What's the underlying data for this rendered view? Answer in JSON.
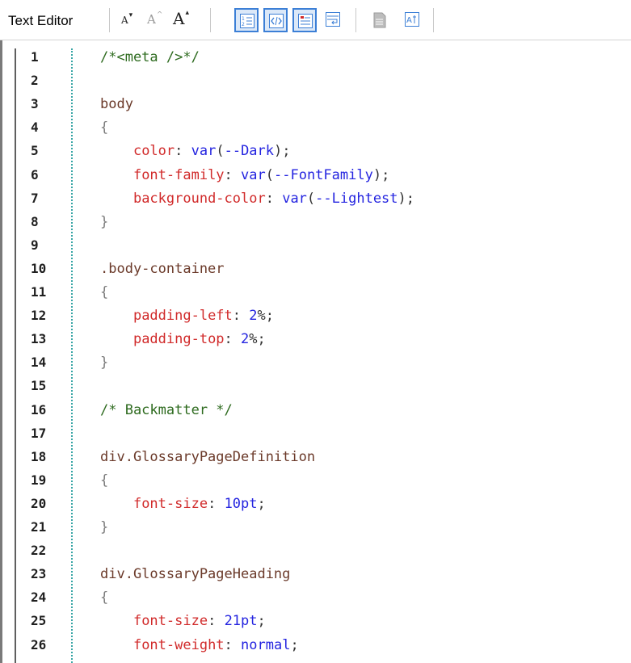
{
  "toolbar": {
    "title": "Text Editor",
    "font_buttons": [
      {
        "label": "A",
        "suffix": "▾",
        "name": "decrease-font-button"
      },
      {
        "label": "A",
        "suffix": "^",
        "name": "default-font-button"
      },
      {
        "label": "A",
        "suffix": "▴",
        "name": "increase-font-button"
      }
    ],
    "icons": [
      {
        "name": "line-numbers-icon",
        "active": true
      },
      {
        "name": "syntax-highlight-icon",
        "active": true
      },
      {
        "name": "show-whitespace-icon",
        "active": true
      },
      {
        "name": "word-wrap-icon",
        "active": false
      },
      {
        "name": "document-icon",
        "active": false
      },
      {
        "name": "font-settings-icon",
        "active": false
      }
    ],
    "accent_color": "#3c7fd6"
  },
  "editor": {
    "lines": [
      {
        "n": "1",
        "tokens": [
          {
            "t": "/*<meta />*/",
            "c": "comment"
          }
        ]
      },
      {
        "n": "2",
        "tokens": []
      },
      {
        "n": "3",
        "tokens": [
          {
            "t": "body",
            "c": "sel"
          }
        ]
      },
      {
        "n": "4",
        "tokens": [
          {
            "t": "{",
            "c": "brace"
          }
        ]
      },
      {
        "n": "5",
        "tokens": [
          {
            "t": "    ",
            "c": "punct"
          },
          {
            "t": "color",
            "c": "prop"
          },
          {
            "t": ": ",
            "c": "punct"
          },
          {
            "t": "var",
            "c": "fn"
          },
          {
            "t": "(",
            "c": "punct"
          },
          {
            "t": "--Dark",
            "c": "var"
          },
          {
            "t": ");",
            "c": "punct"
          }
        ]
      },
      {
        "n": "6",
        "tokens": [
          {
            "t": "    ",
            "c": "punct"
          },
          {
            "t": "font-family",
            "c": "prop"
          },
          {
            "t": ": ",
            "c": "punct"
          },
          {
            "t": "var",
            "c": "fn"
          },
          {
            "t": "(",
            "c": "punct"
          },
          {
            "t": "--FontFamily",
            "c": "var"
          },
          {
            "t": ");",
            "c": "punct"
          }
        ]
      },
      {
        "n": "7",
        "tokens": [
          {
            "t": "    ",
            "c": "punct"
          },
          {
            "t": "background-color",
            "c": "prop"
          },
          {
            "t": ": ",
            "c": "punct"
          },
          {
            "t": "var",
            "c": "fn"
          },
          {
            "t": "(",
            "c": "punct"
          },
          {
            "t": "--Lightest",
            "c": "var"
          },
          {
            "t": ");",
            "c": "punct"
          }
        ]
      },
      {
        "n": "8",
        "tokens": [
          {
            "t": "}",
            "c": "brace"
          }
        ]
      },
      {
        "n": "9",
        "tokens": []
      },
      {
        "n": "10",
        "tokens": [
          {
            "t": ".body-container",
            "c": "sel"
          }
        ]
      },
      {
        "n": "11",
        "tokens": [
          {
            "t": "{",
            "c": "brace"
          }
        ]
      },
      {
        "n": "12",
        "tokens": [
          {
            "t": "    ",
            "c": "punct"
          },
          {
            "t": "padding-left",
            "c": "prop"
          },
          {
            "t": ": ",
            "c": "punct"
          },
          {
            "t": "2",
            "c": "num"
          },
          {
            "t": "%;",
            "c": "punct"
          }
        ]
      },
      {
        "n": "13",
        "tokens": [
          {
            "t": "    ",
            "c": "punct"
          },
          {
            "t": "padding-top",
            "c": "prop"
          },
          {
            "t": ": ",
            "c": "punct"
          },
          {
            "t": "2",
            "c": "num"
          },
          {
            "t": "%;",
            "c": "punct"
          }
        ]
      },
      {
        "n": "14",
        "tokens": [
          {
            "t": "}",
            "c": "brace"
          }
        ]
      },
      {
        "n": "15",
        "tokens": []
      },
      {
        "n": "16",
        "tokens": [
          {
            "t": "/* Backmatter */",
            "c": "comment"
          }
        ]
      },
      {
        "n": "17",
        "tokens": []
      },
      {
        "n": "18",
        "tokens": [
          {
            "t": "div.GlossaryPageDefinition",
            "c": "sel"
          }
        ]
      },
      {
        "n": "19",
        "tokens": [
          {
            "t": "{",
            "c": "brace"
          }
        ]
      },
      {
        "n": "20",
        "tokens": [
          {
            "t": "    ",
            "c": "punct"
          },
          {
            "t": "font-size",
            "c": "prop"
          },
          {
            "t": ": ",
            "c": "punct"
          },
          {
            "t": "10pt",
            "c": "num"
          },
          {
            "t": ";",
            "c": "punct"
          }
        ]
      },
      {
        "n": "21",
        "tokens": [
          {
            "t": "}",
            "c": "brace"
          }
        ]
      },
      {
        "n": "22",
        "tokens": []
      },
      {
        "n": "23",
        "tokens": [
          {
            "t": "div.GlossaryPageHeading",
            "c": "sel"
          }
        ]
      },
      {
        "n": "24",
        "tokens": [
          {
            "t": "{",
            "c": "brace"
          }
        ]
      },
      {
        "n": "25",
        "tokens": [
          {
            "t": "    ",
            "c": "punct"
          },
          {
            "t": "font-size",
            "c": "prop"
          },
          {
            "t": ": ",
            "c": "punct"
          },
          {
            "t": "21pt",
            "c": "num"
          },
          {
            "t": ";",
            "c": "punct"
          }
        ]
      },
      {
        "n": "26",
        "tokens": [
          {
            "t": "    ",
            "c": "punct"
          },
          {
            "t": "font-weight",
            "c": "prop"
          },
          {
            "t": ": ",
            "c": "punct"
          },
          {
            "t": "normal",
            "c": "num"
          },
          {
            "t": ";",
            "c": "punct"
          }
        ]
      }
    ]
  }
}
